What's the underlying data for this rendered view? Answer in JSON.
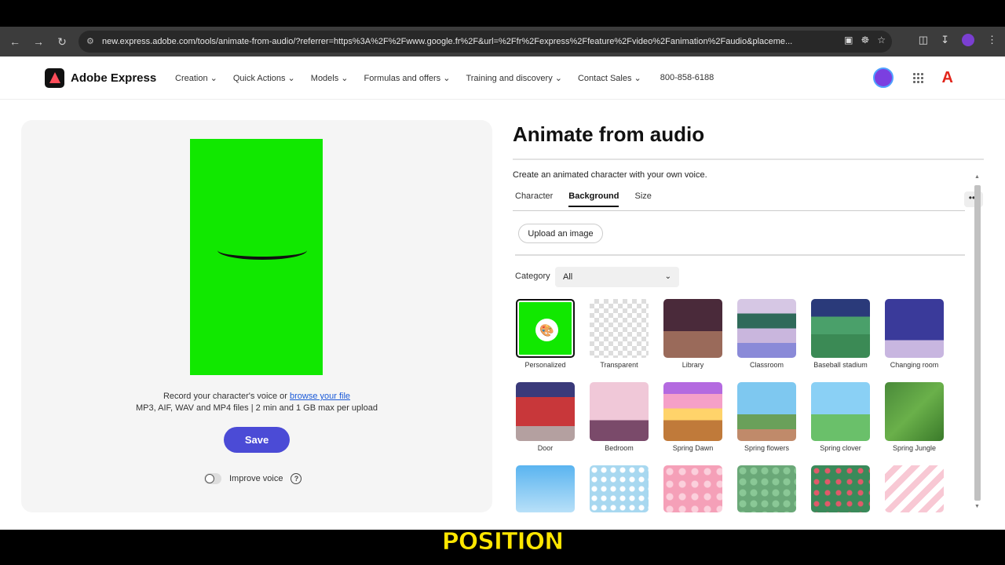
{
  "browser": {
    "url": "new.express.adobe.com/tools/animate-from-audio/?referrer=https%3A%2F%2Fwww.google.fr%2F&url=%2Ffr%2Fexpress%2Ffeature%2Fvideo%2Fanimation%2Faudio&placeme..."
  },
  "header": {
    "logo_text": "Adobe Express",
    "nav": [
      "Creation",
      "Quick Actions",
      "Models",
      "Formulas and offers",
      "Training and discovery",
      "Contact Sales"
    ],
    "phone": "800-858-6188"
  },
  "preview": {
    "bg_color": "#11e800",
    "record_prefix": "Record your character's voice or ",
    "browse_link": "browse your file",
    "formats": "MP3, AIF, WAV and MP4 files | 2 min and 1 GB max per upload",
    "save_label": "Save",
    "improve_voice_label": "Improve voice",
    "improve_voice_on": false
  },
  "panel": {
    "title": "Animate from audio",
    "subtitle": "Create an animated character with your own voice.",
    "tabs": [
      "Character",
      "Background",
      "Size"
    ],
    "active_tab": "Background",
    "more_label": "•••",
    "upload_label": "Upload an image",
    "category_label": "Category",
    "category_value": "All"
  },
  "backgrounds": [
    {
      "label": "Personalized",
      "selected": true
    },
    {
      "label": "Transparent"
    },
    {
      "label": "Library"
    },
    {
      "label": "Classroom"
    },
    {
      "label": "Baseball stadium"
    },
    {
      "label": "Changing room"
    },
    {
      "label": "Door"
    },
    {
      "label": "Bedroom"
    },
    {
      "label": "Spring Dawn"
    },
    {
      "label": "Spring flowers"
    },
    {
      "label": "Spring clover"
    },
    {
      "label": "Spring Jungle"
    },
    {
      "label": ""
    },
    {
      "label": ""
    },
    {
      "label": ""
    },
    {
      "label": ""
    },
    {
      "label": ""
    },
    {
      "label": ""
    }
  ],
  "caption": "POSITION"
}
